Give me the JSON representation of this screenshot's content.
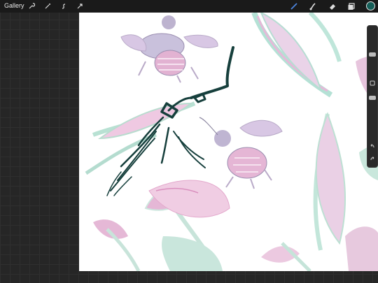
{
  "topbar": {
    "gallery_label": "Gallery",
    "left_tools": [
      "wrench-icon",
      "magic-wand-icon",
      "selection-icon",
      "transform-icon"
    ],
    "right_tools": [
      "brush-icon",
      "smudge-icon",
      "eraser-icon",
      "layers-icon"
    ],
    "current_color": "#155e58"
  },
  "canvas": {
    "background": "#ffffff",
    "stroke_color": "#163f3c",
    "pattern_colors": {
      "pink": "#e7b8d9",
      "mint": "#bfe6da",
      "lavender": "#c8c2dd",
      "grey": "#b8b3c2"
    }
  },
  "sidebar": {
    "size_slider_label": "brush-size-slider",
    "opacity_slider_label": "opacity-slider",
    "modify_button": "square-modify-icon",
    "undo_icon": "undo-icon",
    "redo_icon": "redo-icon"
  }
}
